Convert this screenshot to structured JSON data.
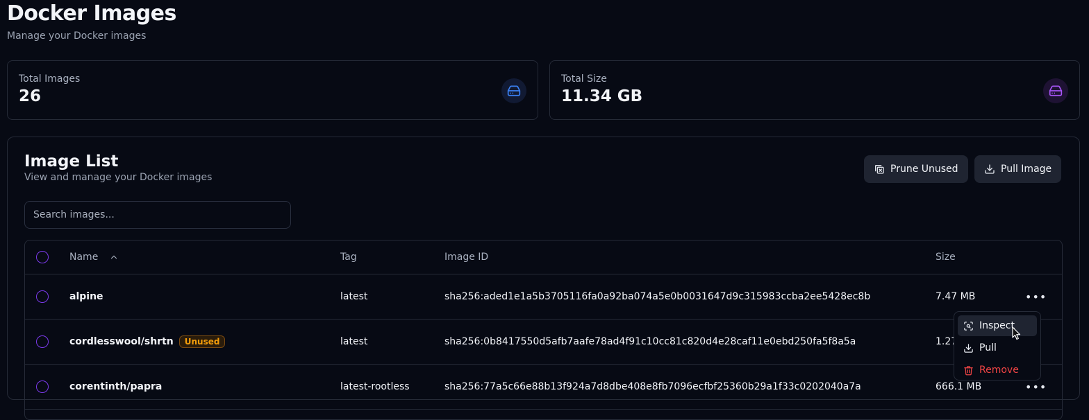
{
  "header": {
    "title": "Docker Images",
    "subtitle": "Manage your Docker images"
  },
  "stats": [
    {
      "label": "Total Images",
      "value": "26",
      "icon": "hard-drive-icon",
      "color": "#3b82f6"
    },
    {
      "label": "Total Size",
      "value": "11.34 GB",
      "icon": "hard-drive-icon",
      "color": "#a855f7"
    }
  ],
  "image_list": {
    "title": "Image List",
    "subtitle": "View and manage your Docker images",
    "prune_label": "Prune Unused",
    "pull_label": "Pull Image",
    "search_placeholder": "Search images...",
    "columns": {
      "name": "Name",
      "tag": "Tag",
      "id": "Image ID",
      "size": "Size"
    },
    "rows": [
      {
        "name": "alpine",
        "badge": "",
        "tag": "latest",
        "id": "sha256:aded1e1a5b3705116fa0a92ba074a5e0b0031647d9c315983ccba2ee5428ec8b",
        "size": "7.47 MB"
      },
      {
        "name": "cordlesswool/shrtn",
        "badge": "Unused",
        "tag": "latest",
        "id": "sha256:0b8417550d5afb7aafe78ad4f91c10cc81c820d4e28caf11e0ebd250fa5f8a5a",
        "size": "1.27"
      },
      {
        "name": "corentinth/papra",
        "badge": "",
        "tag": "latest-rootless",
        "id": "sha256:77a5c66e88b13f924a7d8dbe408e8fb7096ecfbf25360b29a1f33c0202040a7a",
        "size": "666.1 MB"
      }
    ]
  },
  "context_menu": {
    "items": [
      {
        "label": "Inspect",
        "icon": "inspect-icon"
      },
      {
        "label": "Pull",
        "icon": "download-icon"
      },
      {
        "label": "Remove",
        "icon": "trash-icon"
      }
    ]
  },
  "colors": {
    "accent": "#7c3aed",
    "danger": "#ef4444",
    "warning": "#f59e0b"
  }
}
